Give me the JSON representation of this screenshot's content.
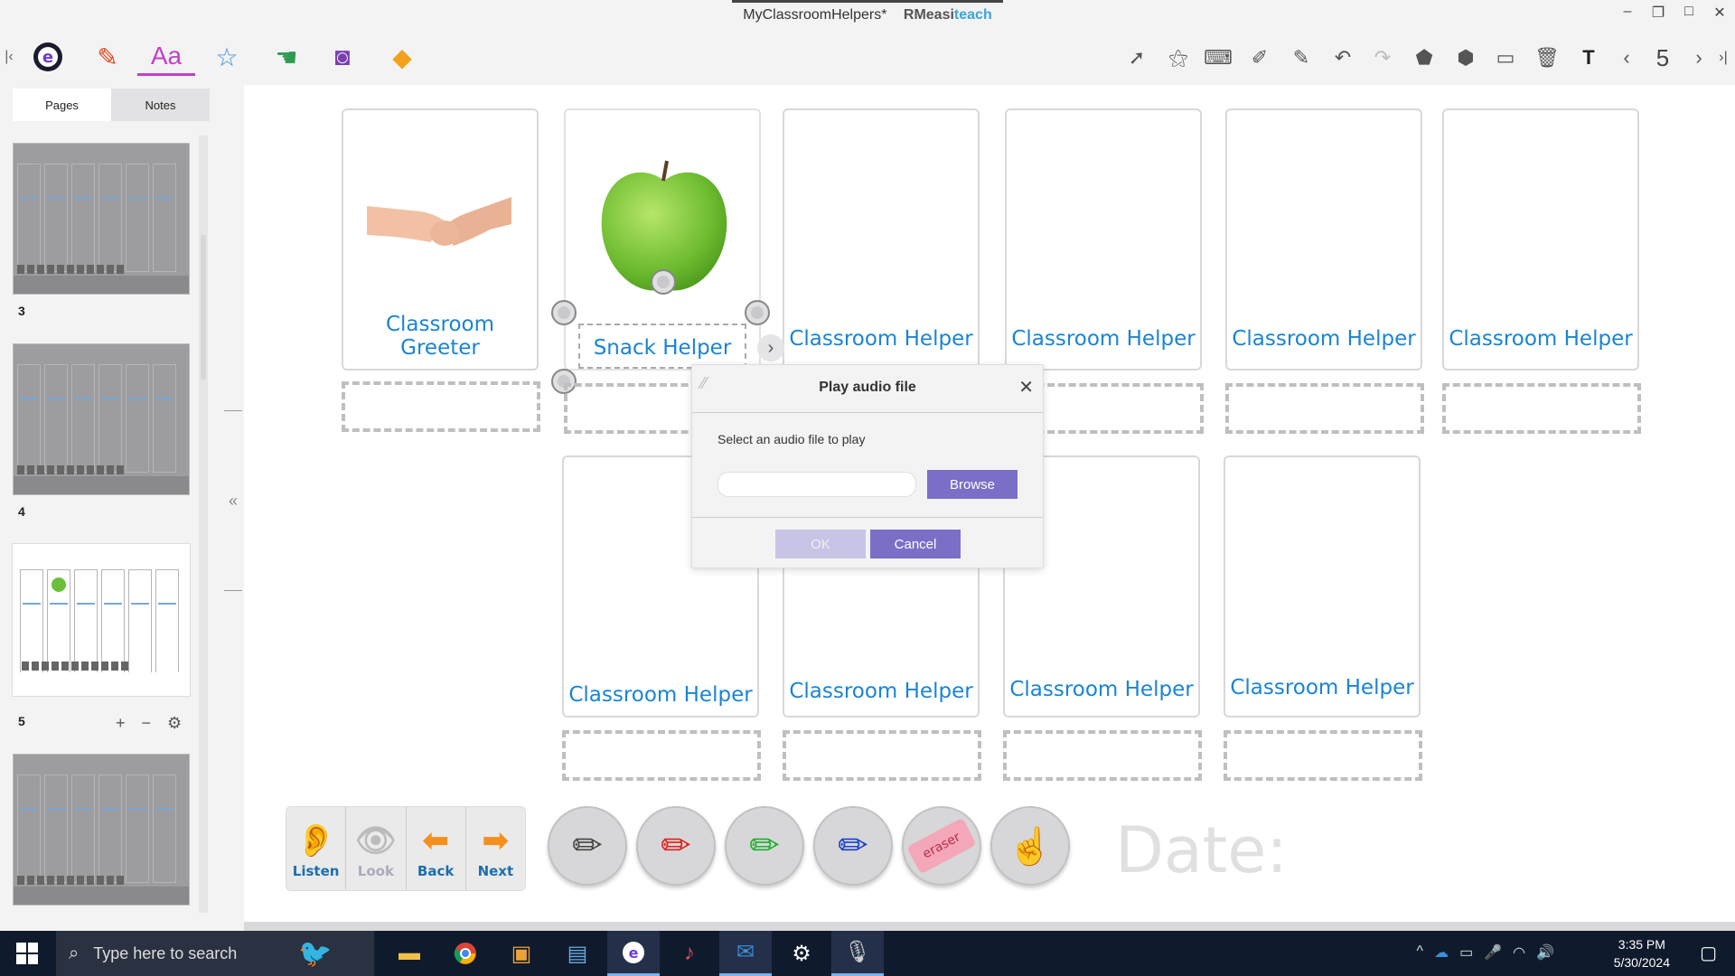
{
  "window": {
    "title": "MyClassroomHelpers*",
    "brand_a": "RM",
    "brand_b": "easi",
    "brand_c": "teach",
    "minimize": "–",
    "restore": "❐",
    "maximize": "□",
    "close": "✕"
  },
  "toolbar": {
    "page_indicator": "5"
  },
  "left_panel": {
    "tabs": [
      "Pages",
      "Notes"
    ],
    "pages": [
      "3",
      "4",
      "5"
    ],
    "add": "+",
    "remove": "−",
    "settings": "⚙",
    "collapse": "«"
  },
  "canvas": {
    "cards_row1": [
      "Classroom Greeter",
      "Snack Helper",
      "Classroom Helper",
      "Classroom Helper",
      "Classroom Helper",
      "Classroom Helper"
    ],
    "cards_row2": [
      "Classroom Helper",
      "Classroom Helper",
      "Classroom Helper",
      "Classroom Helper"
    ],
    "controls": [
      "Listen",
      "Look",
      "Back",
      "Next"
    ],
    "eraser_label": "eraser",
    "date_label": "Date:"
  },
  "dialog": {
    "title": "Play audio file",
    "message": "Select an audio file to play",
    "file_value": "",
    "browse": "Browse",
    "ok": "OK",
    "cancel": "Cancel"
  },
  "taskbar": {
    "search_placeholder": "Type here to search",
    "time": "3:35 PM",
    "date": "5/30/2024"
  },
  "colors": {
    "label_blue": "#1a84d4",
    "dialog_button": "#7a6fc7",
    "accent_font_tool": "#c43fc9"
  }
}
